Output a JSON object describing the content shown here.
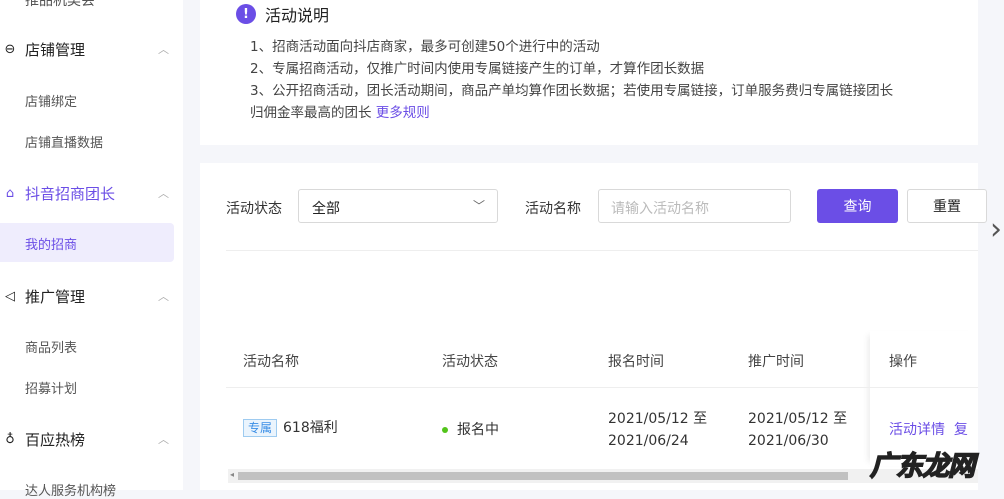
{
  "sidebar": {
    "top_item": "推品机类会",
    "groups": [
      {
        "label": "店铺管理",
        "icon": "store-icon",
        "items": [
          "店铺绑定",
          "店铺直播数据"
        ]
      },
      {
        "label": "抖音招商团长",
        "icon": "briefcase-icon",
        "items": [
          "我的招商"
        ]
      },
      {
        "label": "推广管理",
        "icon": "megaphone-icon",
        "items": [
          "商品列表",
          "招募计划"
        ]
      },
      {
        "label": "百应热榜",
        "icon": "trophy-icon",
        "items": [
          "达人服务机构榜"
        ]
      }
    ]
  },
  "info": {
    "title": "活动说明",
    "lines": [
      "1、招商活动面向抖店商家，最多可创建50个进行中的活动",
      "2、专属招商活动，仅推广时间内使用专属链接产生的订单，才算作团长数据",
      "3、公开招商活动，团长活动期间，商品产单均算作团长数据；若使用专属链接，订单服务费归专属链接团长",
      "归佣金率最高的团长"
    ],
    "more_link": "更多规则"
  },
  "filter": {
    "status_label": "活动状态",
    "status_value": "全部",
    "name_label": "活动名称",
    "name_placeholder": "请输入活动名称",
    "query": "查询",
    "reset": "重置"
  },
  "table": {
    "headers": [
      "活动名称",
      "活动状态",
      "报名时间",
      "推广时间",
      "操作"
    ],
    "rows": [
      {
        "tag": "专属",
        "name": "618福利",
        "status": "报名中",
        "signup_start": "2021/05/12 至",
        "signup_end": "2021/06/24",
        "promo_start": "2021/05/12 至",
        "promo_end": "2021/06/30",
        "action1": "活动详情",
        "action2": "复"
      }
    ]
  },
  "watermark": "广东龙网"
}
